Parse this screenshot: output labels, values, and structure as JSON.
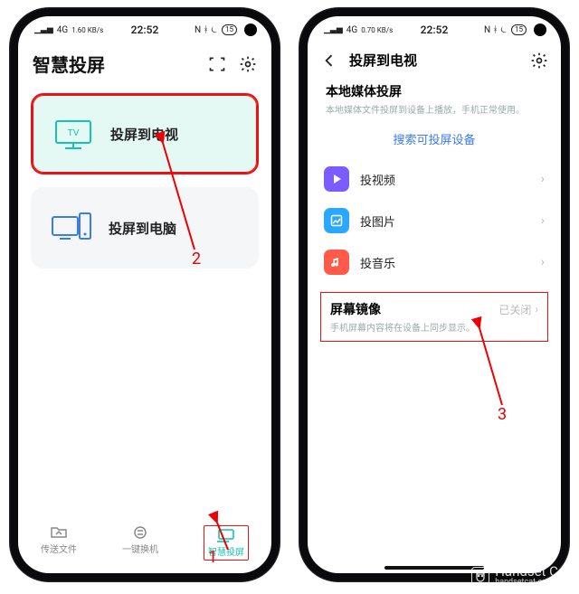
{
  "phone_left": {
    "status": {
      "signal": "4G",
      "net_speed": "1.60 KB/s",
      "time": "22:52",
      "extras": "N ᚼ ⏾",
      "battery": "15"
    },
    "header": {
      "title": "智慧投屏"
    },
    "cards": {
      "tv": {
        "label": "投屏到电视",
        "icon_text": "TV"
      },
      "pc": {
        "label": "投屏到电脑"
      }
    },
    "tabs": {
      "t1": "传送文件",
      "t2": "一键换机",
      "t3": "智慧投屏"
    }
  },
  "phone_right": {
    "status": {
      "signal": "4G",
      "net_speed": "0.70 KB/s",
      "time": "22:52",
      "extras": "N ᚼ ⏾",
      "battery": "15"
    },
    "header": {
      "title": "投屏到电视"
    },
    "section": {
      "title": "本地媒体投屏",
      "sub": "本地媒体文件投屏到设备上播放，手机正常使用。",
      "search_link": "搜索可投屏设备"
    },
    "menu": {
      "video": "投视频",
      "image": "投图片",
      "music": "投音乐"
    },
    "mirror": {
      "title": "屏幕镜像",
      "value": "已关闭",
      "sub": "手机屏幕内容将在设备上同步显示。"
    }
  },
  "annotations": {
    "n1": "1",
    "n2": "2",
    "n3": "3"
  },
  "watermark": {
    "text": "Handset Cat",
    "url": "handsetcat.com"
  },
  "colors": {
    "highlight": "#e11",
    "teal": "#15c3b1",
    "link": "#3a7cf0",
    "video": "#7a5cff",
    "image": "#2aa8ff",
    "music": "#ff5a4a"
  }
}
